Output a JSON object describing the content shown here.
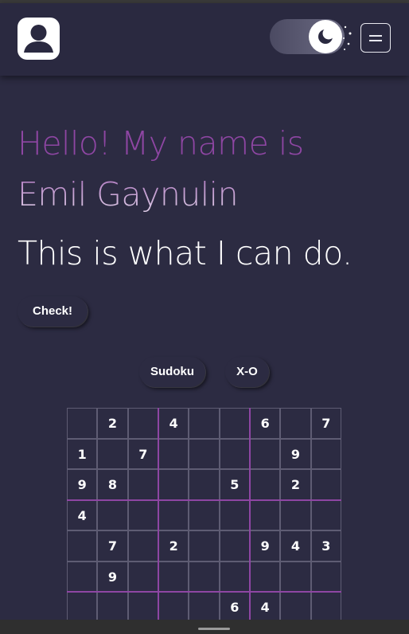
{
  "header": {
    "avatar_icon": "user-avatar-icon",
    "theme_toggle_icon": "moon-icon",
    "menu_icon": "hamburger-menu-icon"
  },
  "hero": {
    "greeting_line1": "Hello! My name is",
    "greeting_line2": "Emil Gaynulin",
    "tagline": "This is what I can do."
  },
  "buttons": {
    "check": "Check!",
    "sudoku": "Sudoku",
    "xo": "X-O"
  },
  "sudoku": {
    "rows": [
      [
        "",
        "2",
        "",
        "4",
        "",
        "",
        "6",
        "",
        "7"
      ],
      [
        "1",
        "",
        "7",
        "",
        "",
        "",
        "",
        "9",
        ""
      ],
      [
        "9",
        "8",
        "",
        "",
        "",
        "5",
        "",
        "2",
        ""
      ],
      [
        "4",
        "",
        "",
        "",
        "",
        "",
        "",
        "",
        ""
      ],
      [
        "",
        "7",
        "",
        "2",
        "",
        "",
        "9",
        "4",
        "3"
      ],
      [
        "",
        "9",
        "",
        "",
        "",
        "",
        "",
        "",
        ""
      ],
      [
        "",
        "",
        "",
        "",
        "",
        "6",
        "4",
        "",
        ""
      ]
    ]
  },
  "colors": {
    "background": "#2c2b42",
    "accent": "#8e46a3"
  }
}
